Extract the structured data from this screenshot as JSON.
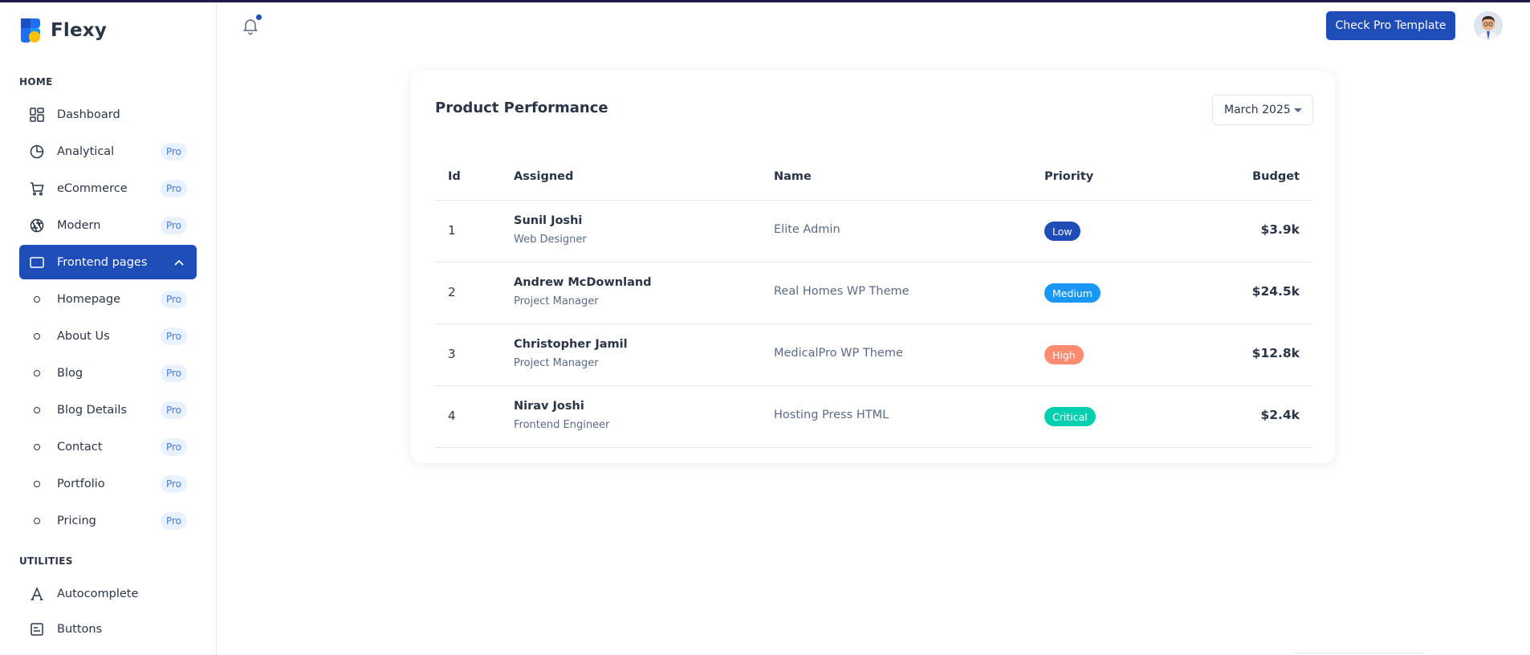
{
  "app": {
    "name": "Flexy"
  },
  "colors": {
    "primary": "#1e4db7",
    "low": "#1e4db7",
    "medium": "#1a97f5",
    "high": "#fc8b6f",
    "critical": "#00cfb0",
    "pro_bg": "#e8f2ff"
  },
  "sidebar": {
    "home_title": "HOME",
    "utilities_title": "UTILITIES",
    "items": [
      {
        "label": "Dashboard",
        "icon": "dashboard-icon",
        "pro": ""
      },
      {
        "label": "Analytical",
        "icon": "pie-chart-icon",
        "pro": "Pro"
      },
      {
        "label": "eCommerce",
        "icon": "shopping-cart-icon",
        "pro": "Pro"
      },
      {
        "label": "Modern",
        "icon": "aperture-icon",
        "pro": "Pro"
      },
      {
        "label": "Frontend pages",
        "icon": "app-window-icon",
        "pro": ""
      },
      {
        "label": "Homepage",
        "icon": "circle-dot-icon",
        "pro": "Pro"
      },
      {
        "label": "About Us",
        "icon": "circle-dot-icon",
        "pro": "Pro"
      },
      {
        "label": "Blog",
        "icon": "circle-dot-icon",
        "pro": "Pro"
      },
      {
        "label": "Blog Details",
        "icon": "circle-dot-icon",
        "pro": "Pro"
      },
      {
        "label": "Contact",
        "icon": "circle-dot-icon",
        "pro": "Pro"
      },
      {
        "label": "Portfolio",
        "icon": "circle-dot-icon",
        "pro": "Pro"
      },
      {
        "label": "Pricing",
        "icon": "circle-dot-icon",
        "pro": "Pro"
      }
    ],
    "utilities": [
      {
        "label": "Autocomplete",
        "icon": "typography-icon"
      },
      {
        "label": "Buttons",
        "icon": "button-icon"
      }
    ]
  },
  "header": {
    "pro_button": "Check Pro Template"
  },
  "card": {
    "title": "Product Performance",
    "month": "March 2025",
    "columns": [
      "Id",
      "Assigned",
      "Name",
      "Priority",
      "Budget"
    ],
    "rows": [
      {
        "id": "1",
        "name": "Sunil Joshi",
        "role": "Web Designer",
        "product": "Elite Admin",
        "priority": "Low",
        "budget": "$3.9k"
      },
      {
        "id": "2",
        "name": "Andrew McDownland",
        "role": "Project Manager",
        "product": "Real Homes WP Theme",
        "priority": "Medium",
        "budget": "$24.5k"
      },
      {
        "id": "3",
        "name": "Christopher Jamil",
        "role": "Project Manager",
        "product": "MedicalPro WP Theme",
        "priority": "High",
        "budget": "$12.8k"
      },
      {
        "id": "4",
        "name": "Nirav Joshi",
        "role": "Frontend Engineer",
        "product": "Hosting Press HTML",
        "priority": "Critical",
        "budget": "$2.4k"
      }
    ]
  }
}
